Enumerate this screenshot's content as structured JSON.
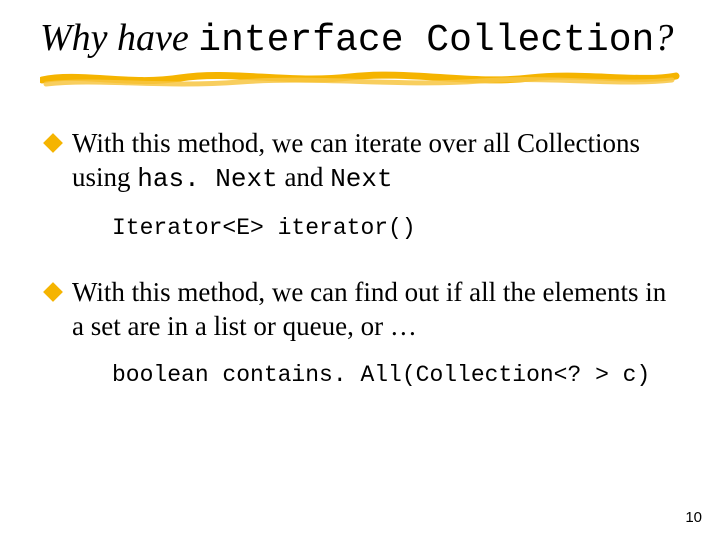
{
  "title": {
    "prefix": "Why have ",
    "code": "interface Collection",
    "suffix": "?"
  },
  "bullets": [
    {
      "pre": "With this method, we can iterate over all Collections using ",
      "code1": "has. Next",
      "mid": " and ",
      "code2": "Next",
      "codeblock": "Iterator<E> iterator()"
    },
    {
      "text": "With this method, we can find out if all the elements in a set are in a list or queue, or …",
      "codeblock": "boolean contains. All(Collection<? > c)"
    }
  ],
  "page_number": "10"
}
